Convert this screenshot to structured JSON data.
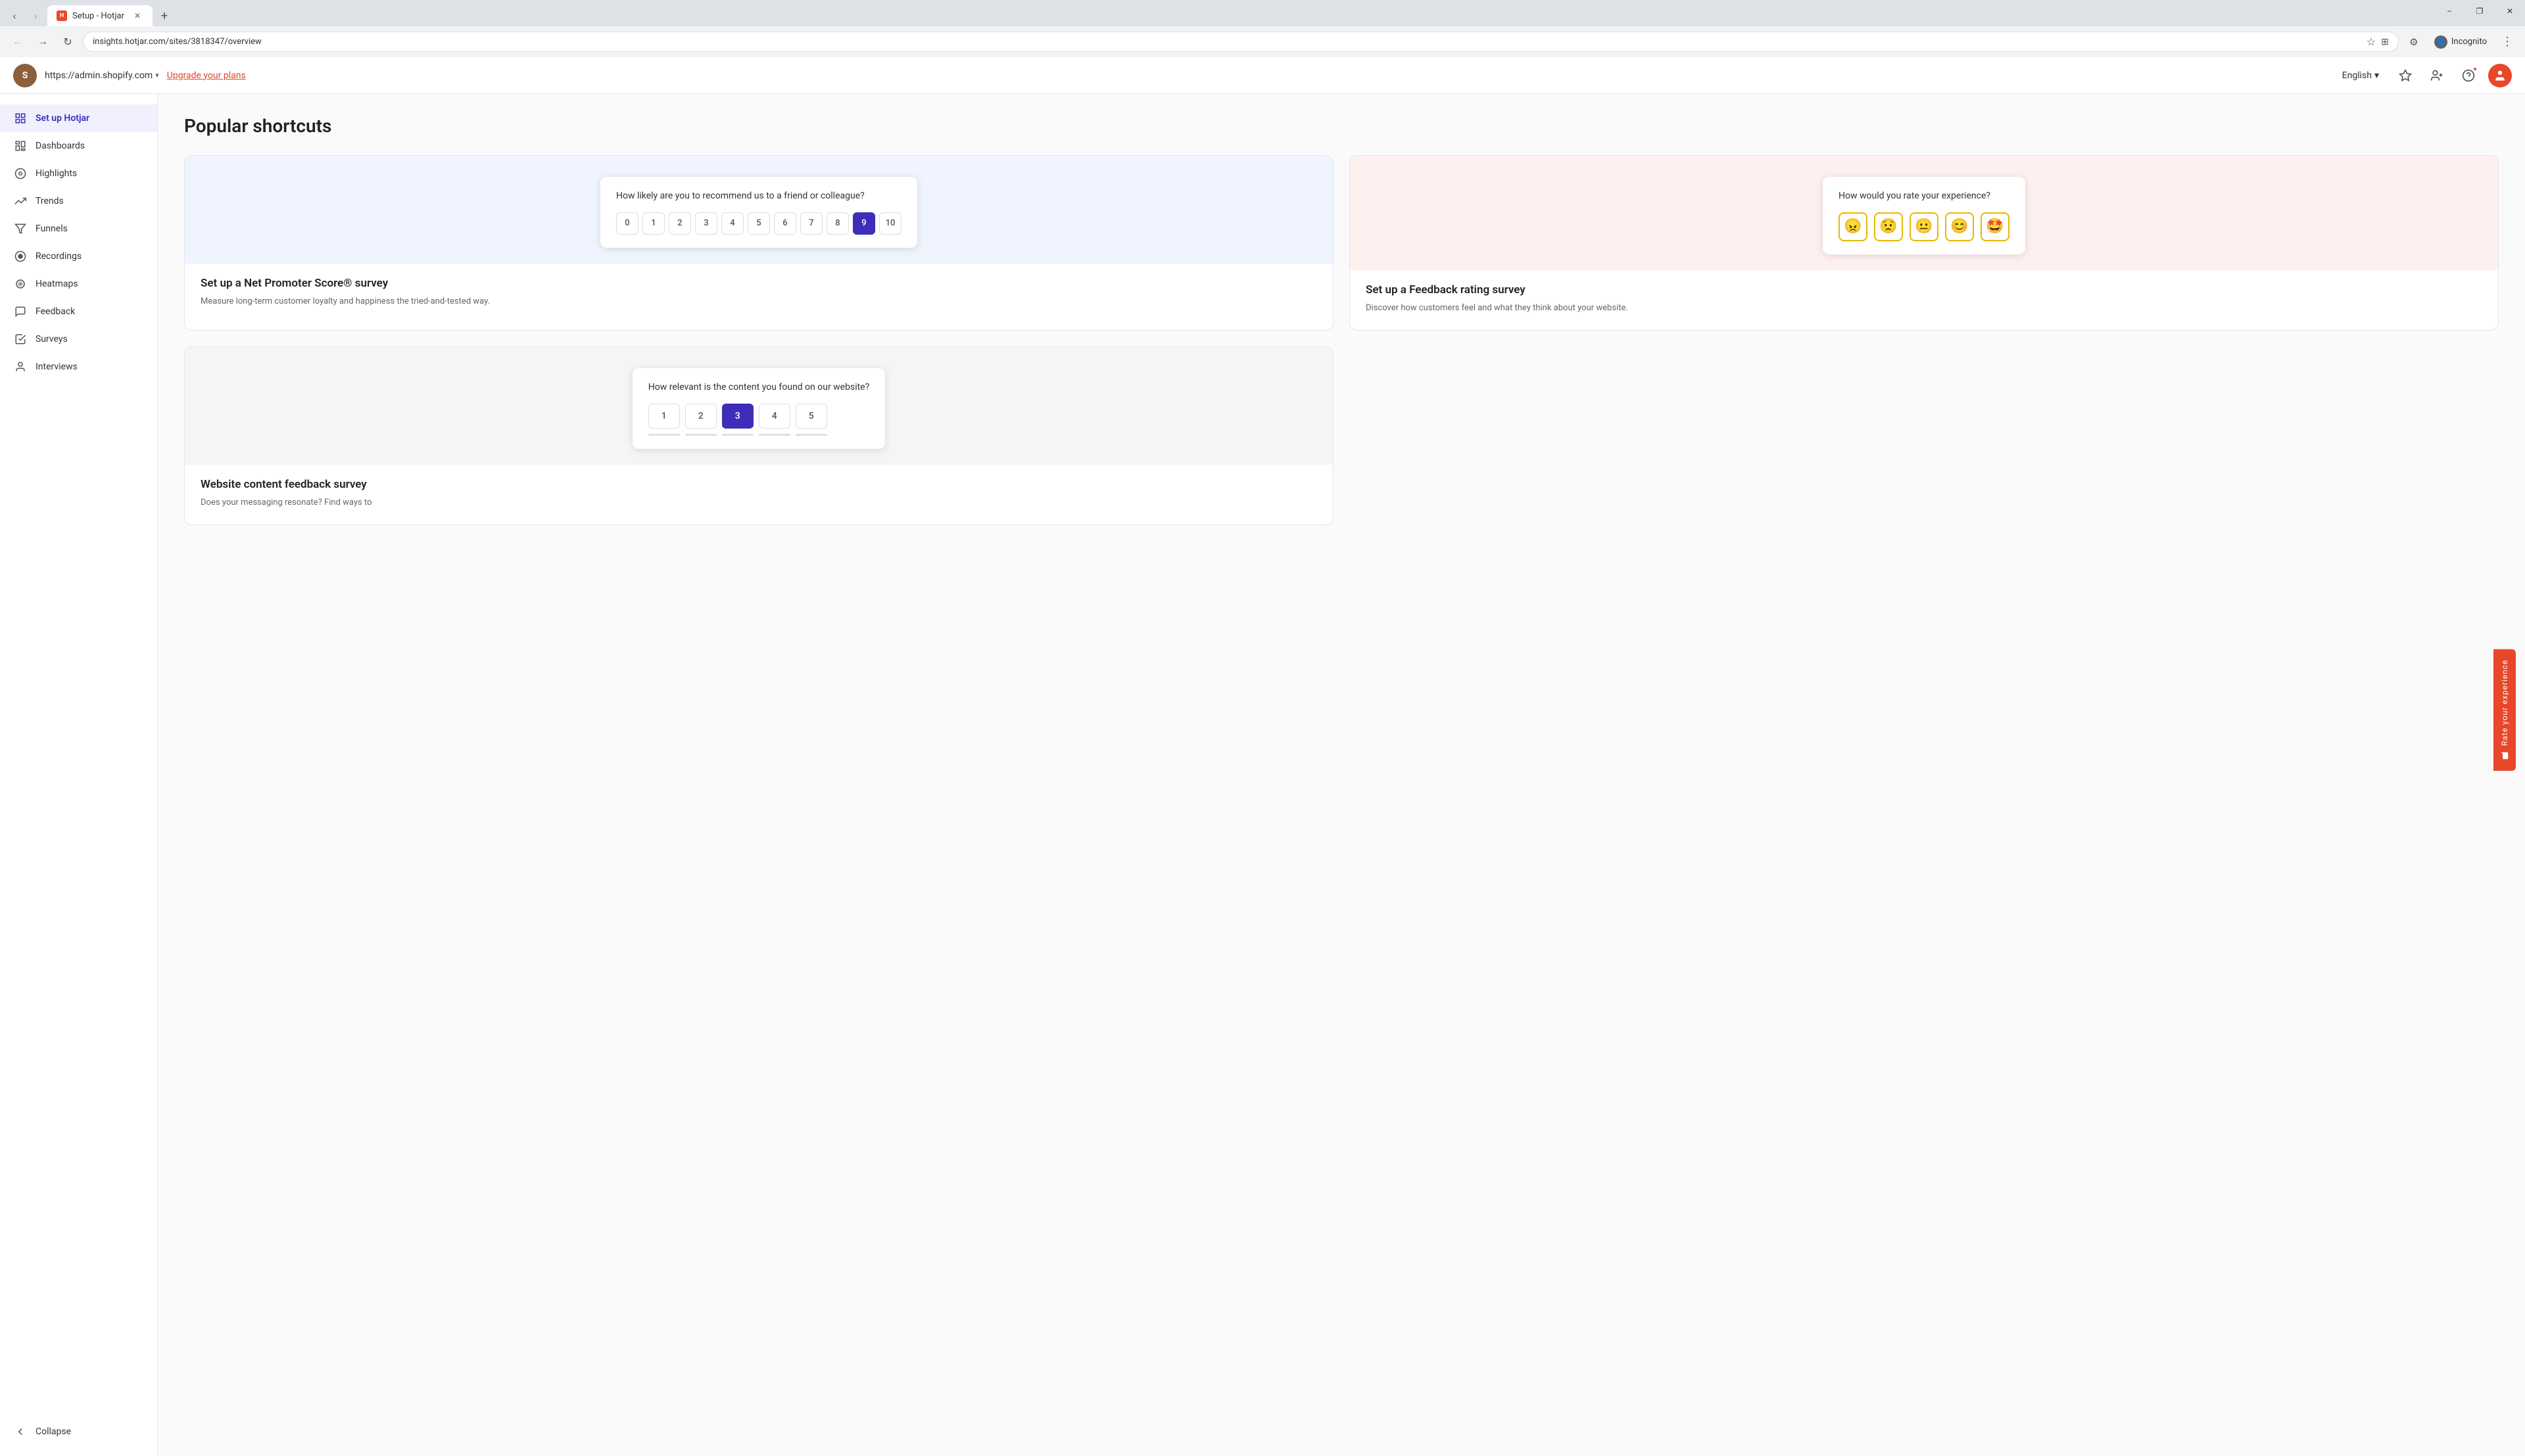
{
  "browser": {
    "tab_title": "Setup - Hotjar",
    "tab_url": "insights.hotjar.com/sites/3818347/overview",
    "address_url": "insights.hotjar.com/sites/3818347/overview",
    "new_tab_label": "+",
    "incognito_label": "Incognito",
    "window_minimize": "−",
    "window_restore": "❐",
    "window_close": "✕"
  },
  "app_header": {
    "domain": "https://admin.shopify.com",
    "domain_arrow": "▾",
    "upgrade_link": "Upgrade your plans",
    "language": "English",
    "language_arrow": "▾"
  },
  "sidebar": {
    "active_item": "Set up Hotjar",
    "items": [
      {
        "id": "setup",
        "label": "Set up Hotjar",
        "icon": "⊞"
      },
      {
        "id": "dashboards",
        "label": "Dashboards",
        "icon": "⊟"
      },
      {
        "id": "highlights",
        "label": "Highlights",
        "icon": "◎"
      },
      {
        "id": "trends",
        "label": "Trends",
        "icon": "↗"
      },
      {
        "id": "funnels",
        "label": "Funnels",
        "icon": "⬡"
      },
      {
        "id": "recordings",
        "label": "Recordings",
        "icon": "⏺"
      },
      {
        "id": "heatmaps",
        "label": "Heatmaps",
        "icon": "⊛"
      },
      {
        "id": "feedback",
        "label": "Feedback",
        "icon": "⬡"
      },
      {
        "id": "surveys",
        "label": "Surveys",
        "icon": "☑"
      },
      {
        "id": "interviews",
        "label": "Interviews",
        "icon": "👤"
      }
    ],
    "collapse_label": "Collapse",
    "collapse_icon": "←"
  },
  "main": {
    "page_title": "Popular shortcuts",
    "cards": [
      {
        "id": "nps",
        "title": "Set up a Net Promoter Score® survey",
        "description": "Measure long-term customer loyalty and happiness the tried-and-tested way.",
        "preview_bg": "nps-bg",
        "survey_question": "How likely are you to recommend us to a friend or colleague?",
        "scale_type": "nps",
        "scale_values": [
          "0",
          "1",
          "2",
          "3",
          "4",
          "5",
          "6",
          "7",
          "8",
          "9",
          "10"
        ],
        "selected_value": "9"
      },
      {
        "id": "feedback-rating",
        "title": "Set up a Feedback rating survey",
        "description": "Discover how customers feel and what they think about your website.",
        "preview_bg": "feedback-bg",
        "survey_question": "How would you rate your experience?",
        "scale_type": "emoji",
        "emojis": [
          "😠",
          "😟",
          "😐",
          "😊",
          "🤩"
        ]
      },
      {
        "id": "website-content",
        "title": "Website content feedback survey",
        "description": "Does your messaging resonate? Find ways to",
        "preview_bg": "content-bg",
        "survey_question": "How relevant is the content you found on our website?",
        "scale_type": "likert",
        "scale_values": [
          "1",
          "2",
          "3",
          "4",
          "5"
        ],
        "selected_value": "3"
      }
    ]
  },
  "rate_experience": {
    "label": "Rate your experience"
  }
}
